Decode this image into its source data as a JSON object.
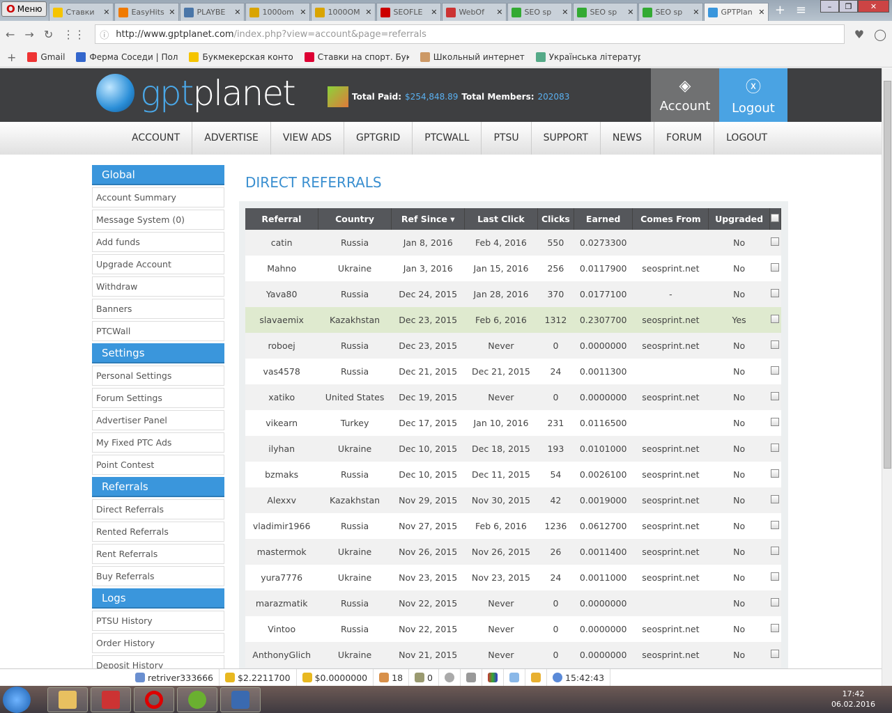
{
  "browser": {
    "menu_label": "Меню",
    "tabs": [
      {
        "title": "Ставки",
        "color": "#f5c400"
      },
      {
        "title": "EasyHits",
        "color": "#f07a00"
      },
      {
        "title": "PLAYBE",
        "color": "#4a76a8"
      },
      {
        "title": "1000om",
        "color": "#d9a400"
      },
      {
        "title": "1000OM",
        "color": "#d9a400"
      },
      {
        "title": "SEOFLE",
        "color": "#c00"
      },
      {
        "title": "WebOf",
        "color": "#c33"
      },
      {
        "title": "SEO sp",
        "color": "#3a3"
      },
      {
        "title": "SEO sp",
        "color": "#3a3"
      },
      {
        "title": "SEO sp",
        "color": "#3a3"
      },
      {
        "title": "GPTPlan",
        "color": "#3a96dc",
        "active": true
      }
    ],
    "url_domain": "http://www.gptplanet.com",
    "url_path": "/index.php?view=account&page=referrals",
    "bookmarks": [
      {
        "label": "Gmail",
        "color": "#e33"
      },
      {
        "label": "Ферма Соседи | Пол",
        "color": "#36c"
      },
      {
        "label": "Букмекерская конто",
        "color": "#f5c400"
      },
      {
        "label": "Ставки на спорт. Бук",
        "color": "#d03"
      },
      {
        "label": "Школьный интернет",
        "color": "#c96"
      },
      {
        "label": "Українська літератур",
        "color": "#5a8"
      }
    ]
  },
  "header": {
    "logo_a": "gpt",
    "logo_b": "planet",
    "total_paid_label": "Total Paid:",
    "total_paid": "$254,848.89",
    "total_members_label": "Total Members:",
    "total_members": "202083",
    "account_label": "Account",
    "logout_label": "Logout"
  },
  "nav": [
    "ACCOUNT",
    "ADVERTISE",
    "VIEW ADS",
    "GPTGRID",
    "PTCWALL",
    "PTSU",
    "SUPPORT",
    "NEWS",
    "FORUM",
    "LOGOUT"
  ],
  "sidebar": [
    {
      "heading": "Global",
      "items": [
        "Account Summary",
        "Message System (0)",
        "Add funds",
        "Upgrade Account",
        "Withdraw",
        "Banners",
        "PTCWall"
      ]
    },
    {
      "heading": "Settings",
      "items": [
        "Personal Settings",
        "Forum Settings",
        "Advertiser Panel",
        "My Fixed PTC Ads",
        "Point Contest"
      ]
    },
    {
      "heading": "Referrals",
      "items": [
        "Direct Referrals",
        "Rented Referrals",
        "Rent Referrals",
        "Buy Referrals"
      ]
    },
    {
      "heading": "Logs",
      "items": [
        "PTSU History",
        "Order History",
        "Deposit History"
      ]
    }
  ],
  "page_title": "DIRECT REFERRALS",
  "table": {
    "columns": [
      "Referral",
      "Country",
      "Ref Since ▾",
      "Last Click",
      "Clicks",
      "Earned",
      "Comes From",
      "Upgraded"
    ],
    "rows": [
      [
        "catin",
        "Russia",
        "Jan 8, 2016",
        "Feb 4, 2016",
        "550",
        "0.0273300",
        "",
        "No"
      ],
      [
        "Mahno",
        "Ukraine",
        "Jan 3, 2016",
        "Jan 15, 2016",
        "256",
        "0.0117900",
        "seosprint.net",
        "No"
      ],
      [
        "Yava80",
        "Russia",
        "Dec 24, 2015",
        "Jan 28, 2016",
        "370",
        "0.0177100",
        "-",
        "No"
      ],
      [
        "slavaemix",
        "Kazakhstan",
        "Dec 23, 2015",
        "Feb 6, 2016",
        "1312",
        "0.2307700",
        "seosprint.net",
        "Yes"
      ],
      [
        "roboej",
        "Russia",
        "Dec 23, 2015",
        "Never",
        "0",
        "0.0000000",
        "seosprint.net",
        "No"
      ],
      [
        "vas4578",
        "Russia",
        "Dec 21, 2015",
        "Dec 21, 2015",
        "24",
        "0.0011300",
        "",
        "No"
      ],
      [
        "xatiko",
        "United States",
        "Dec 19, 2015",
        "Never",
        "0",
        "0.0000000",
        "seosprint.net",
        "No"
      ],
      [
        "vikearn",
        "Turkey",
        "Dec 17, 2015",
        "Jan 10, 2016",
        "231",
        "0.0116500",
        "",
        "No"
      ],
      [
        "ilyhan",
        "Ukraine",
        "Dec 10, 2015",
        "Dec 18, 2015",
        "193",
        "0.0101000",
        "seosprint.net",
        "No"
      ],
      [
        "bzmaks",
        "Russia",
        "Dec 10, 2015",
        "Dec 11, 2015",
        "54",
        "0.0026100",
        "seosprint.net",
        "No"
      ],
      [
        "Alexxv",
        "Kazakhstan",
        "Nov 29, 2015",
        "Nov 30, 2015",
        "42",
        "0.0019000",
        "seosprint.net",
        "No"
      ],
      [
        "vladimir1966",
        "Russia",
        "Nov 27, 2015",
        "Feb 6, 2016",
        "1236",
        "0.0612700",
        "seosprint.net",
        "No"
      ],
      [
        "mastermok",
        "Ukraine",
        "Nov 26, 2015",
        "Nov 26, 2015",
        "26",
        "0.0011400",
        "seosprint.net",
        "No"
      ],
      [
        "yura7776",
        "Ukraine",
        "Nov 23, 2015",
        "Nov 23, 2015",
        "24",
        "0.0011000",
        "seosprint.net",
        "No"
      ],
      [
        "marazmatik",
        "Russia",
        "Nov 22, 2015",
        "Never",
        "0",
        "0.0000000",
        "",
        "No"
      ],
      [
        "Vintoo",
        "Russia",
        "Nov 22, 2015",
        "Never",
        "0",
        "0.0000000",
        "seosprint.net",
        "No"
      ],
      [
        "AnthonyGlich",
        "Ukraine",
        "Nov 21, 2015",
        "Never",
        "0",
        "0.0000000",
        "seosprint.net",
        "No"
      ]
    ]
  },
  "statusbar": {
    "username": "retriver333666",
    "balance": "$2.2211700",
    "purchase_balance": "$0.0000000",
    "referrals": "18",
    "rented": "0",
    "time": "15:42:43"
  },
  "taskbar": {
    "time": "17:42",
    "date": "06.02.2016"
  }
}
